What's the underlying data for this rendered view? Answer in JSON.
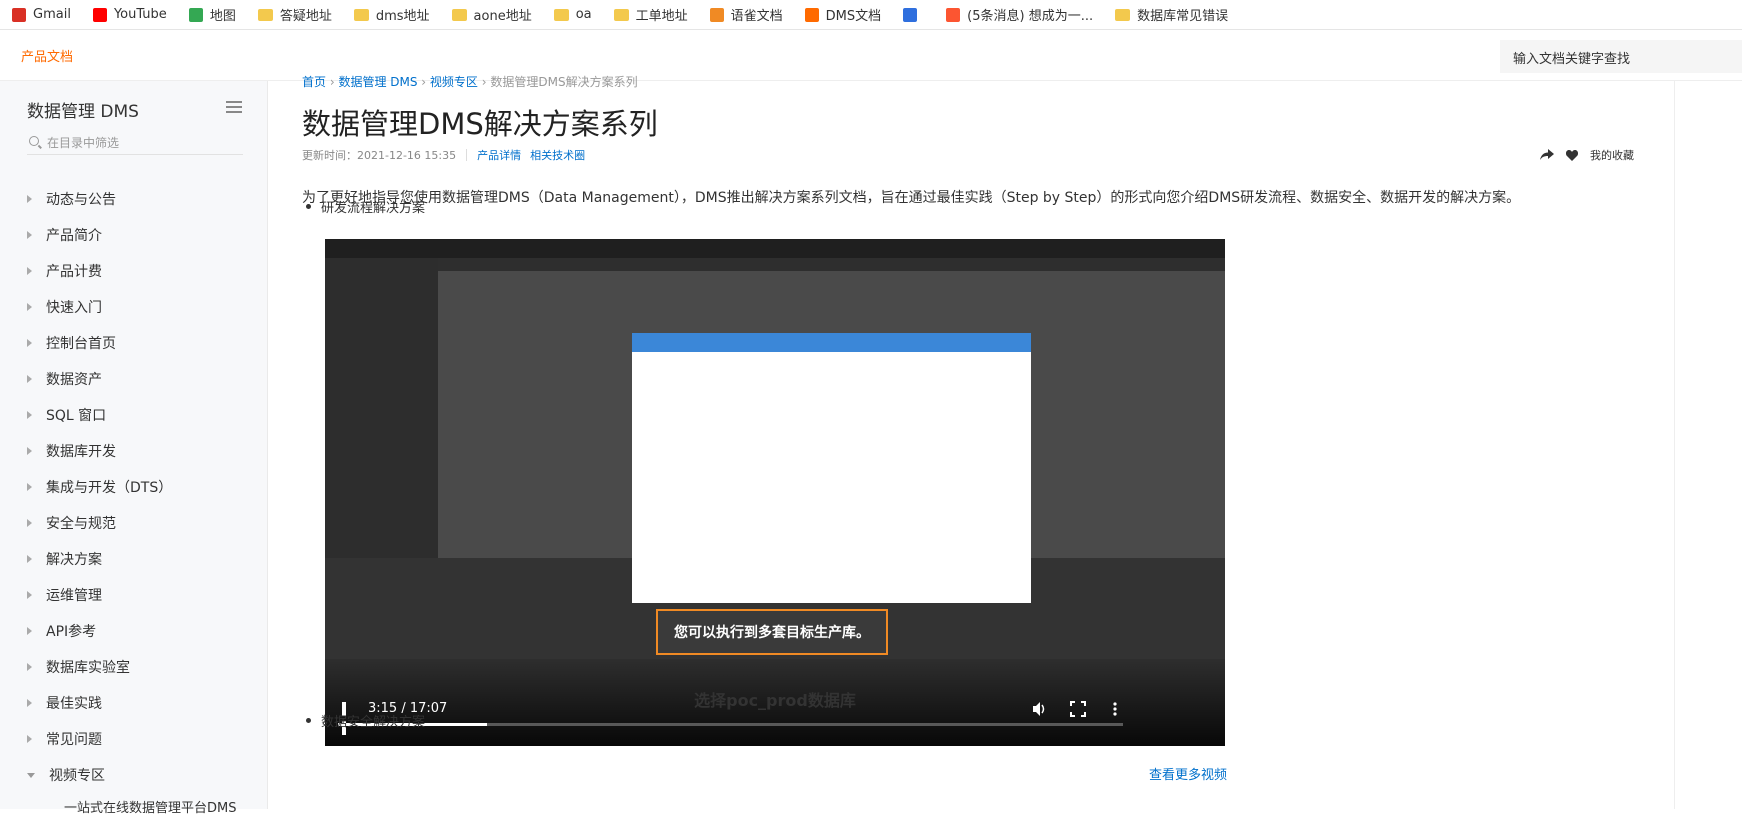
{
  "bookmarks": [
    {
      "label": "Gmail",
      "icon": "gmail-icon",
      "color": "#d93025"
    },
    {
      "label": "YouTube",
      "icon": "youtube-icon",
      "color": "#ff0000"
    },
    {
      "label": "地图",
      "icon": "maps-icon",
      "color": "#34a853"
    },
    {
      "label": "答疑地址",
      "icon": "folder-icon"
    },
    {
      "label": "dms地址",
      "icon": "folder-icon"
    },
    {
      "label": "aone地址",
      "icon": "folder-icon"
    },
    {
      "label": "oa",
      "icon": "folder-icon"
    },
    {
      "label": "工单地址",
      "icon": "folder-icon"
    },
    {
      "label": "语雀文档",
      "icon": "yuque-icon",
      "color": "#f08a24"
    },
    {
      "label": "DMS文档",
      "icon": "aliyun-icon",
      "color": "#ff6a00"
    },
    {
      "label": "",
      "icon": "translate-icon",
      "color": "#2f6fde"
    },
    {
      "label": "(5条消息) 想成为一...",
      "icon": "csdn-icon",
      "color": "#fc5531"
    },
    {
      "label": "数据库常见错误",
      "icon": "folder-icon"
    }
  ],
  "topnav": {
    "brand": "产品文档",
    "search_placeholder": "输入文档关键字查找"
  },
  "sidebar": {
    "title": "数据管理 DMS",
    "filter_placeholder": "在目录中筛选",
    "items": [
      {
        "label": "动态与公告"
      },
      {
        "label": "产品简介"
      },
      {
        "label": "产品计费"
      },
      {
        "label": "快速入门"
      },
      {
        "label": "控制台首页"
      },
      {
        "label": "数据资产"
      },
      {
        "label": "SQL 窗口"
      },
      {
        "label": "数据库开发"
      },
      {
        "label": "集成与开发（DTS）"
      },
      {
        "label": "安全与规范"
      },
      {
        "label": "解决方案"
      },
      {
        "label": "运维管理"
      },
      {
        "label": "API参考"
      },
      {
        "label": "数据库实验室"
      },
      {
        "label": "最佳实践"
      },
      {
        "label": "常见问题"
      },
      {
        "label": "视频专区",
        "expanded": true
      }
    ],
    "sub_item": "一站式在线数据管理平台DMS"
  },
  "main": {
    "breadcrumb": [
      "首页",
      "数据管理 DMS",
      "视频专区",
      "数据管理DMS解决方案系列"
    ],
    "title": "数据管理DMS解决方案系列",
    "updated": "更新时间：2021-12-16 15:35",
    "links": [
      "产品详情",
      "相关技术圈"
    ],
    "favorite": "我的收藏",
    "intro": "为了更好地指导您使用数据管理DMS（Data Management），DMS推出解决方案系列文档，旨在通过最佳实践（Step by Step）的形式向您介绍DMS研发流程、数据安全、数据开发的解决方案。",
    "bullets": [
      "研发流程解决方案",
      "数据安全解决方案"
    ],
    "more_videos": "查看更多视频"
  },
  "video": {
    "tooltip": "您可以执行到多套目标生产库。",
    "caption": "选择poc_prod数据库",
    "time": "3:15 / 17:07",
    "progress": 0.19
  }
}
